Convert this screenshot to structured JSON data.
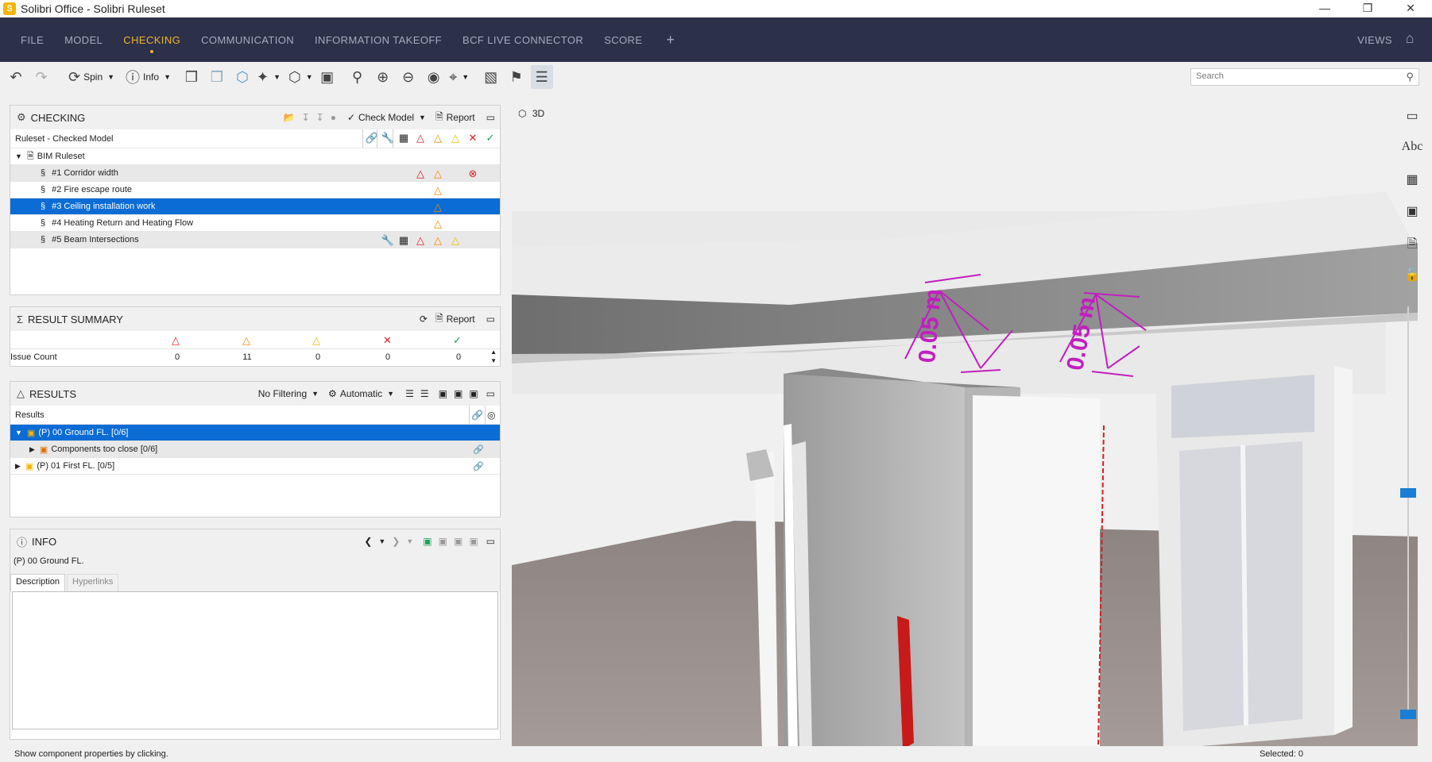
{
  "window": {
    "title": "Solibri Office - Solibri Ruleset",
    "app_icon_letter": "S"
  },
  "menu": {
    "items": [
      "FILE",
      "MODEL",
      "CHECKING",
      "COMMUNICATION",
      "INFORMATION TAKEOFF",
      "BCF LIVE CONNECTOR",
      "SCORE"
    ],
    "active": "CHECKING",
    "plus": "+",
    "views": "VIEWS"
  },
  "toolbar": {
    "spin": "Spin",
    "info": "Info"
  },
  "search": {
    "placeholder": "Search"
  },
  "checking": {
    "title": "CHECKING",
    "check_model": "Check Model",
    "report": "Report",
    "header_label": "Ruleset - Checked Model",
    "ruleset_name": "BIM Ruleset",
    "rules": [
      {
        "label": "#1 Corridor width",
        "icons": [
          "red-tri",
          "orange-tri",
          "red-x"
        ]
      },
      {
        "label": "#2 Fire escape route",
        "icons": [
          "orange-tri"
        ]
      },
      {
        "label": "#3 Ceiling installation work",
        "icons": [
          "orange-tri"
        ]
      },
      {
        "label": "#4 Heating Return and Heating Flow",
        "icons": [
          "orange-tri"
        ]
      },
      {
        "label": "#5 Beam Intersections",
        "icons": [
          "red-tri",
          "orange-tri",
          "yellow-tri"
        ]
      }
    ]
  },
  "summary": {
    "title": "RESULT SUMMARY",
    "report": "Report",
    "row_label": "Issue Count",
    "counts": [
      "0",
      "11",
      "0",
      "0",
      "0"
    ]
  },
  "results": {
    "title": "RESULTS",
    "filter": "No Filtering",
    "mode": "Automatic",
    "header": "Results",
    "rows": [
      {
        "label": "(P) 00 Ground FL. [0/6]"
      },
      {
        "label": "Components too close [0/6]"
      },
      {
        "label": "(P) 01 First FL. [0/5]"
      }
    ]
  },
  "info": {
    "title": "INFO",
    "selected_name": "(P) 00 Ground FL.",
    "tabs": [
      "Description",
      "Hyperlinks"
    ]
  },
  "viewport": {
    "label": "3D",
    "dimensions": [
      "0.05 m",
      "0.05 m"
    ]
  },
  "status": {
    "hint": "Show component properties by clicking.",
    "selected": "Selected: 0"
  }
}
